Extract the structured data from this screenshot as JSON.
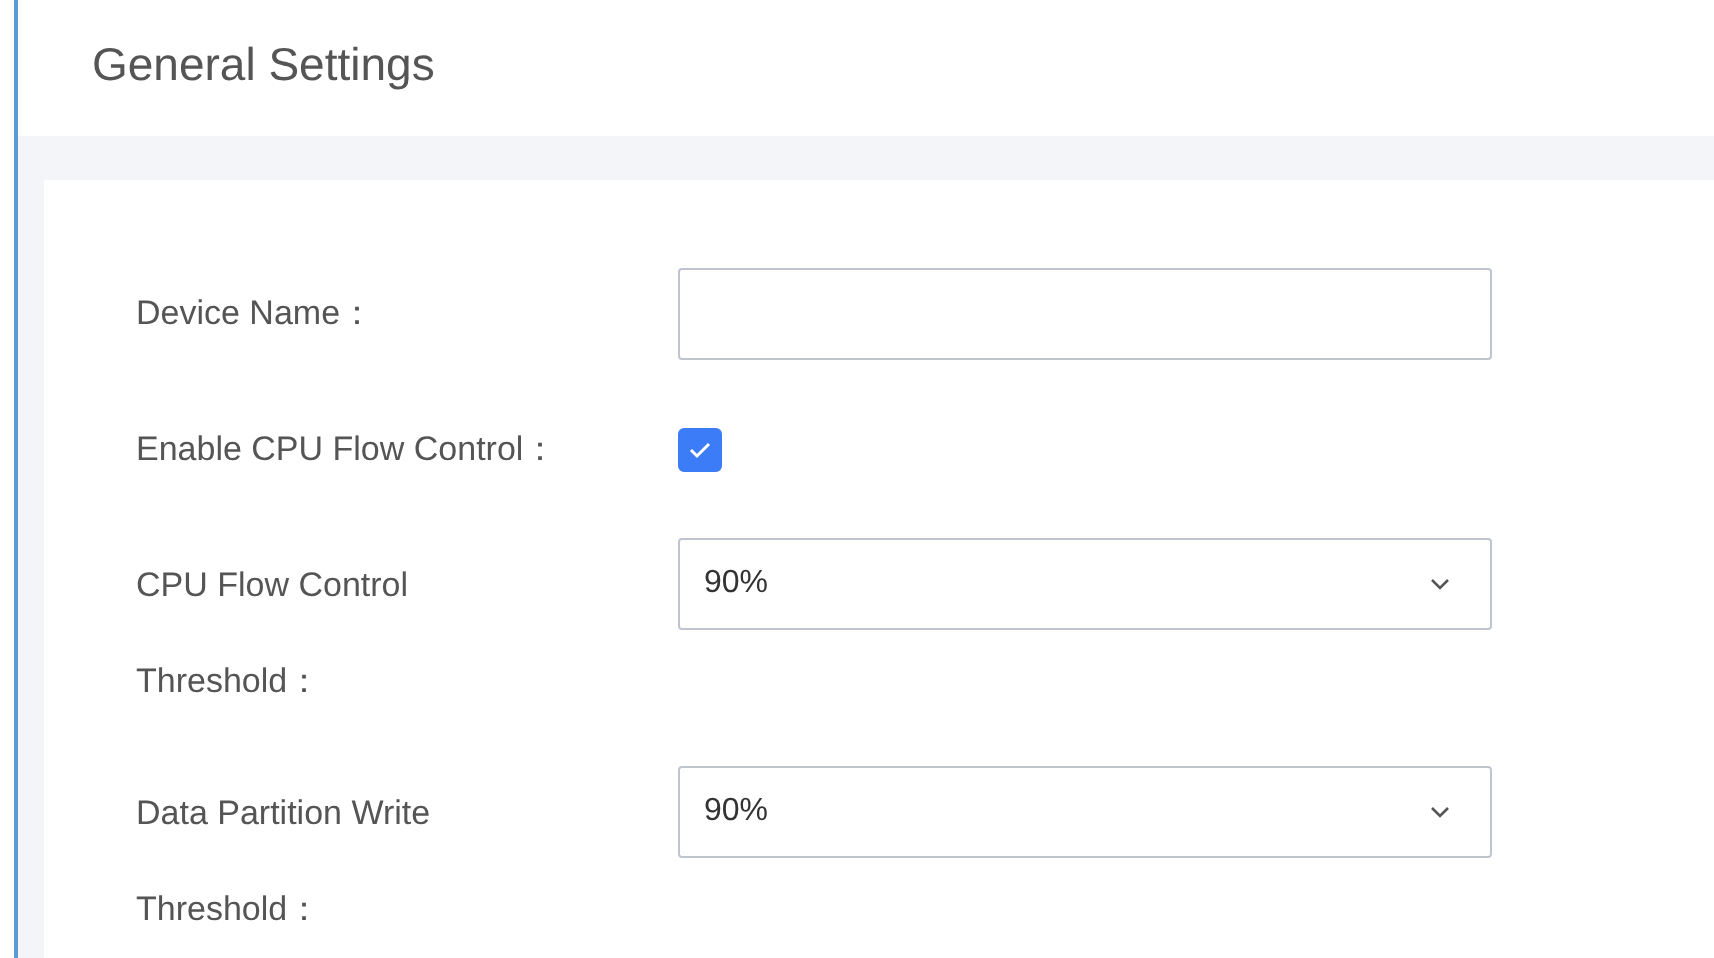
{
  "title": "General Settings",
  "fields": [
    {
      "kind": "text",
      "label": "Device Name："
    },
    {
      "kind": "checkbox",
      "label": "Enable CPU Flow Control：",
      "checked": true
    },
    {
      "kind": "select",
      "label": "CPU Flow Control Threshold：",
      "value": "90%"
    },
    {
      "kind": "select",
      "label": "Data Partition Write Threshold：",
      "value": "90%"
    }
  ]
}
